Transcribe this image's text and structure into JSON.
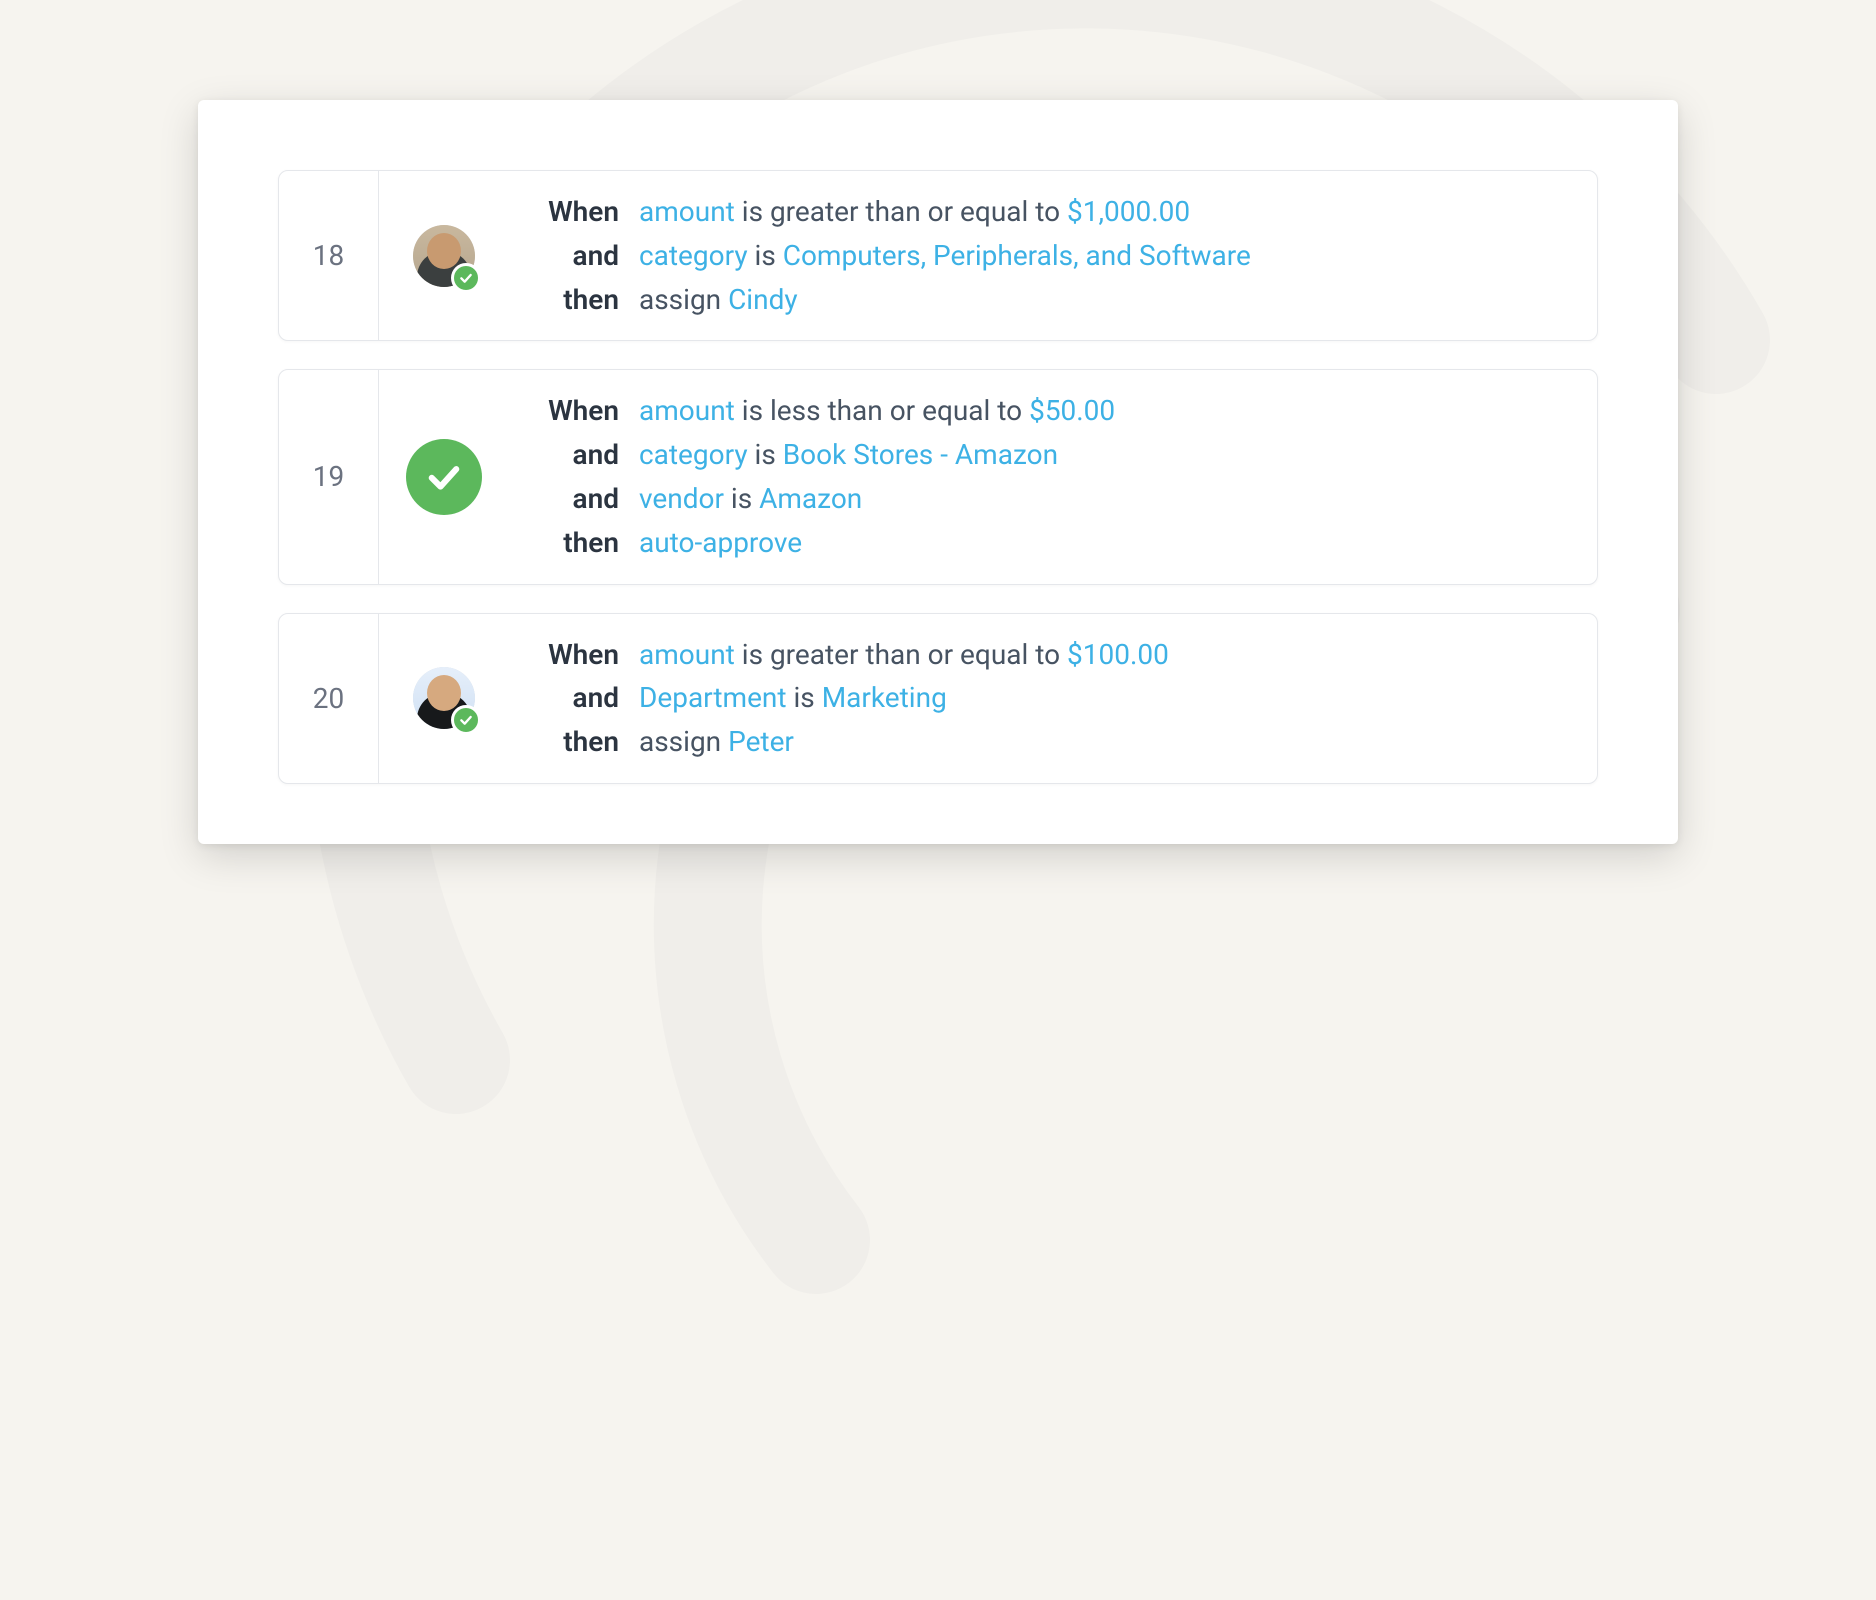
{
  "labels": {
    "when": "When",
    "and": "and",
    "then": "then"
  },
  "rules": [
    {
      "number": "18",
      "avatar": {
        "type": "user",
        "variant": 1
      },
      "lines": [
        {
          "label": "when",
          "parts": [
            {
              "t": "amount",
              "kw": true
            },
            {
              "t": " is greater than or equal to ",
              "kw": false
            },
            {
              "t": "$1,000.00",
              "kw": true
            }
          ]
        },
        {
          "label": "and",
          "parts": [
            {
              "t": "category",
              "kw": true
            },
            {
              "t": " is ",
              "kw": false
            },
            {
              "t": "Computers, Peripherals, and Software",
              "kw": true
            }
          ]
        },
        {
          "label": "then",
          "parts": [
            {
              "t": "assign ",
              "kw": false
            },
            {
              "t": "Cindy",
              "kw": true
            }
          ]
        }
      ]
    },
    {
      "number": "19",
      "avatar": {
        "type": "check"
      },
      "lines": [
        {
          "label": "when",
          "parts": [
            {
              "t": "amount",
              "kw": true
            },
            {
              "t": " is less than or equal to ",
              "kw": false
            },
            {
              "t": "$50.00",
              "kw": true
            }
          ]
        },
        {
          "label": "and",
          "parts": [
            {
              "t": "category",
              "kw": true
            },
            {
              "t": " is ",
              "kw": false
            },
            {
              "t": "Book Stores - Amazon",
              "kw": true
            }
          ]
        },
        {
          "label": "and",
          "parts": [
            {
              "t": "vendor",
              "kw": true
            },
            {
              "t": " is ",
              "kw": false
            },
            {
              "t": "Amazon",
              "kw": true
            }
          ]
        },
        {
          "label": "then",
          "parts": [
            {
              "t": "auto-approve",
              "kw": true
            }
          ]
        }
      ]
    },
    {
      "number": "20",
      "avatar": {
        "type": "user",
        "variant": 3
      },
      "lines": [
        {
          "label": "when",
          "parts": [
            {
              "t": "amount",
              "kw": true
            },
            {
              "t": " is greater than or equal to ",
              "kw": false
            },
            {
              "t": "$100.00",
              "kw": true
            }
          ]
        },
        {
          "label": "and",
          "parts": [
            {
              "t": "Department",
              "kw": true
            },
            {
              "t": " is ",
              "kw": false
            },
            {
              "t": "Marketing",
              "kw": true
            }
          ]
        },
        {
          "label": "then",
          "parts": [
            {
              "t": "assign ",
              "kw": false
            },
            {
              "t": "Peter",
              "kw": true
            }
          ]
        }
      ]
    }
  ]
}
